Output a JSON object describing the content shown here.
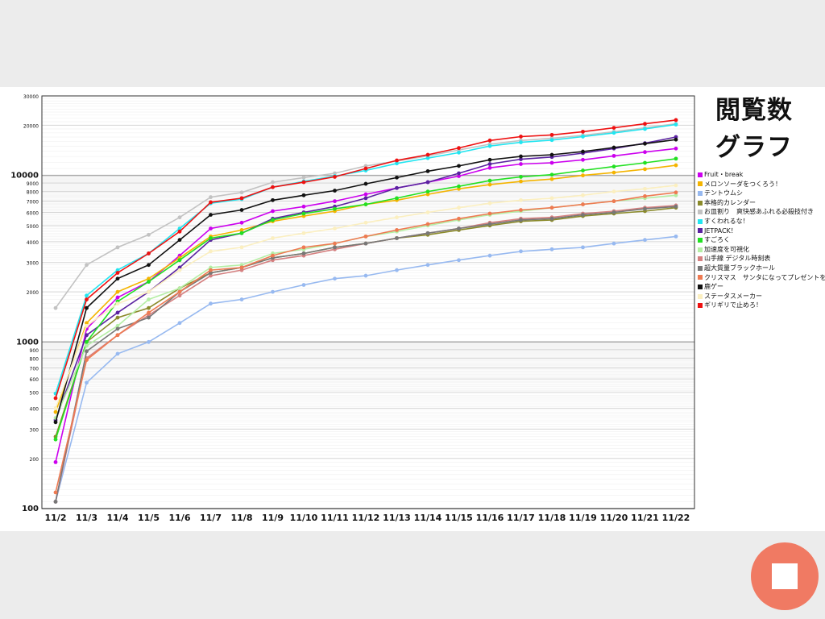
{
  "chart_data": {
    "type": "line",
    "title": [
      "閲覧数",
      "グラフ"
    ],
    "xlabel": "",
    "ylabel": "",
    "yscale": "log",
    "ylim": [
      100,
      30000
    ],
    "y_ticks": [
      100,
      200,
      300,
      400,
      500,
      600,
      700,
      800,
      900,
      1000,
      2000,
      3000,
      4000,
      5000,
      6000,
      7000,
      8000,
      9000,
      10000,
      20000,
      30000
    ],
    "y_tick_labels": [
      "100",
      "200",
      "300",
      "400",
      "500",
      "600",
      "700",
      "800",
      "900",
      "1000",
      "2000",
      "3000",
      "4000",
      "5000",
      "6000",
      "7000",
      "8000",
      "9000",
      "10000",
      "20000",
      "30000"
    ],
    "grid": true,
    "legend_position": "right",
    "categories": [
      "11/2",
      "11/3",
      "11/4",
      "11/5",
      "11/6",
      "11/7",
      "11/8",
      "11/9",
      "11/10",
      "11/11",
      "11/12",
      "11/13",
      "11/14",
      "11/15",
      "11/16",
      "11/17",
      "11/18",
      "11/19",
      "11/20",
      "11/21",
      "11/22"
    ],
    "series": [
      {
        "name": "Fruit・break",
        "color": "#cc00ee",
        "values": [
          190,
          1200,
          1850,
          2300,
          3300,
          4800,
          5200,
          6100,
          6500,
          7000,
          7700,
          8400,
          9100,
          9900,
          11100,
          11700,
          11900,
          12400,
          13100,
          13800,
          14500
        ]
      },
      {
        "name": "メロンソーダをつくろう！",
        "color": "#f4b400",
        "values": [
          380,
          1300,
          2000,
          2400,
          3200,
          4300,
          4700,
          5300,
          5700,
          6100,
          6700,
          7100,
          7700,
          8300,
          8800,
          9200,
          9500,
          10000,
          10400,
          10900,
          11500
        ]
      },
      {
        "name": "テントウムシ",
        "color": "#97b9f0",
        "values": [
          110,
          570,
          850,
          1000,
          1300,
          1700,
          1800,
          2000,
          2200,
          2400,
          2500,
          2700,
          2900,
          3100,
          3300,
          3500,
          3600,
          3700,
          3900,
          4100,
          4300
        ]
      },
      {
        "name": "本格的カレンダー",
        "color": "#8a8a2a",
        "values": [
          270,
          1000,
          1400,
          1600,
          2100,
          2600,
          2800,
          3200,
          3400,
          3700,
          3900,
          4200,
          4400,
          4700,
          5000,
          5300,
          5400,
          5700,
          5900,
          6100,
          6400
        ]
      },
      {
        "name": "お皿割り　爽快感あふれる必殺技付き",
        "color": "#c2c2c2",
        "values": [
          1600,
          2900,
          3700,
          4400,
          5600,
          7400,
          7900,
          9100,
          9700,
          10300,
          11400,
          12200,
          13100,
          14200,
          15400,
          16200,
          16700,
          17400,
          18300,
          19300,
          20400
        ]
      },
      {
        "name": "すくわれるな！",
        "color": "#22e5f0",
        "values": [
          490,
          1900,
          2700,
          3400,
          4800,
          6800,
          7200,
          8500,
          9200,
          9900,
          10700,
          11800,
          12700,
          13700,
          15000,
          15800,
          16300,
          17100,
          18000,
          19000,
          20200
        ]
      },
      {
        "name": "JETPACK！",
        "color": "#5a22a0",
        "values": [
          340,
          1100,
          1500,
          2000,
          2800,
          4100,
          4500,
          5500,
          6000,
          6500,
          7300,
          8400,
          9100,
          10300,
          11700,
          12500,
          12900,
          13600,
          14500,
          15600,
          17000
        ]
      },
      {
        "name": "すごろく",
        "color": "#22e022",
        "values": [
          260,
          1000,
          1750,
          2300,
          3100,
          4200,
          4500,
          5400,
          5900,
          6300,
          6700,
          7300,
          8000,
          8600,
          9300,
          9800,
          10100,
          10700,
          11300,
          11900,
          12600
        ]
      },
      {
        "name": "加速度を可視化",
        "color": "#b5eea5",
        "values": [
          350,
          950,
          1250,
          1800,
          2100,
          2800,
          2900,
          3400,
          3600,
          3900,
          4300,
          4600,
          5000,
          5400,
          5800,
          6100,
          6400,
          6700,
          7000,
          7300,
          7600
        ]
      },
      {
        "name": "山手線 デジタル時刻表",
        "color": "#d58080",
        "values": [
          110,
          800,
          1100,
          1450,
          1900,
          2500,
          2700,
          3100,
          3300,
          3600,
          3900,
          4200,
          4500,
          4800,
          5200,
          5500,
          5600,
          5900,
          6100,
          6400,
          6600
        ]
      },
      {
        "name": "超大質量ブラックホール",
        "color": "#777777",
        "values": [
          110,
          880,
          1200,
          1400,
          2000,
          2600,
          2800,
          3200,
          3400,
          3700,
          3900,
          4200,
          4500,
          4800,
          5100,
          5400,
          5500,
          5800,
          6000,
          6300,
          6500
        ]
      },
      {
        "name": "クリスマス　サンタになってプレゼントをあげよう",
        "color": "#ee7a52",
        "values": [
          125,
          780,
          1100,
          1500,
          2000,
          2700,
          2800,
          3300,
          3700,
          3900,
          4300,
          4700,
          5100,
          5500,
          5900,
          6200,
          6400,
          6700,
          7000,
          7500,
          7900
        ]
      },
      {
        "name": "鹿ゲー",
        "color": "#111111",
        "values": [
          330,
          1600,
          2400,
          2900,
          4100,
          5800,
          6200,
          7100,
          7600,
          8100,
          8900,
          9700,
          10600,
          11400,
          12400,
          13000,
          13300,
          13900,
          14700,
          15500,
          16400
        ]
      },
      {
        "name": "ステータスメーカー",
        "color": "#fbefc0",
        "values": [
          400,
          1250,
          1700,
          2000,
          2700,
          3500,
          3700,
          4200,
          4500,
          4800,
          5200,
          5600,
          6000,
          6400,
          6800,
          7100,
          7300,
          7600,
          8000,
          8300,
          8700
        ]
      },
      {
        "name": "ギリギリで止めろ！",
        "color": "#ee1111",
        "values": [
          460,
          1800,
          2600,
          3400,
          4600,
          6900,
          7300,
          8500,
          9100,
          9800,
          11000,
          12300,
          13300,
          14600,
          16200,
          17100,
          17500,
          18300,
          19300,
          20400,
          21500
        ]
      }
    ]
  },
  "controls": {
    "stop_icon": "stop-square-icon",
    "stop_button_color": "#f07a63"
  }
}
